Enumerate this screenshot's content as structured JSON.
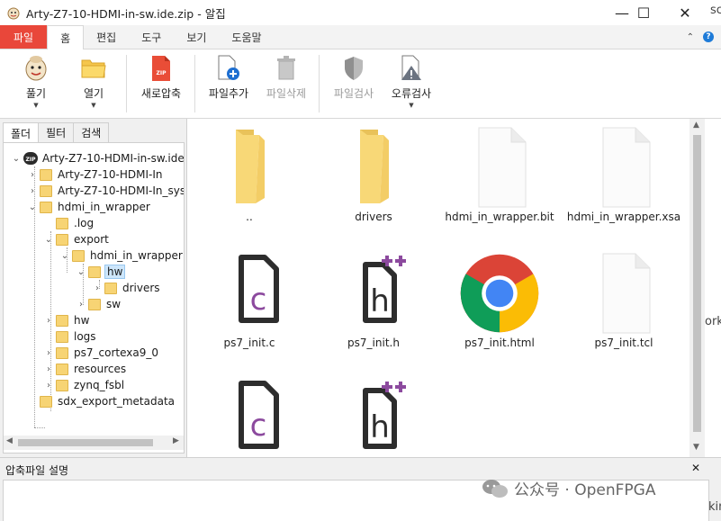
{
  "window": {
    "title": "Arty-Z7-10-HDMI-in-sw.ide.zip - 알집",
    "minimize": "—",
    "maximize": "☐",
    "close": "✕"
  },
  "ribbon_tabs": [
    "파일",
    "홈",
    "편집",
    "도구",
    "보기",
    "도움말"
  ],
  "ribbon": {
    "unzip": "풀기",
    "open": "열기",
    "new_zip": "새로압축",
    "add_file": "파일추가",
    "delete_file": "파일삭제",
    "check_file": "파일검사",
    "error_check": "오류검사"
  },
  "left_tabs": [
    "폴더",
    "필터",
    "검색"
  ],
  "tree": [
    {
      "label": "Arty-Z7-10-HDMI-in-sw.ide."
    },
    {
      "label": "Arty-Z7-10-HDMI-In"
    },
    {
      "label": "Arty-Z7-10-HDMI-In_sys"
    },
    {
      "label": "hdmi_in_wrapper"
    },
    {
      "label": ".log"
    },
    {
      "label": "export"
    },
    {
      "label": "hdmi_in_wrapper"
    },
    {
      "label": "hw"
    },
    {
      "label": "drivers"
    },
    {
      "label": "sw"
    },
    {
      "label": "hw"
    },
    {
      "label": "logs"
    },
    {
      "label": "ps7_cortexa9_0"
    },
    {
      "label": "resources"
    },
    {
      "label": "zynq_fsbl"
    },
    {
      "label": "sdx_export_metadata"
    }
  ],
  "files": [
    {
      "name": "..",
      "icon": "folder-icon"
    },
    {
      "name": "drivers",
      "icon": "folder-icon"
    },
    {
      "name": "hdmi_in_wrapper.bit",
      "icon": "blank-file-icon"
    },
    {
      "name": "hdmi_in_wrapper.xsa",
      "icon": "blank-file-icon"
    },
    {
      "name": "ps7_init.c",
      "icon": "c-source-icon"
    },
    {
      "name": "ps7_init.h",
      "icon": "h-header-icon"
    },
    {
      "name": "ps7_init.html",
      "icon": "chrome-icon"
    },
    {
      "name": "ps7_init.tcl",
      "icon": "blank-file-icon"
    },
    {
      "name": "",
      "icon": "c-source-icon"
    },
    {
      "name": "",
      "icon": "h-header-icon"
    }
  ],
  "bottom": {
    "title": "압축파일 설명",
    "close": "✕"
  },
  "watermark": "公众号 · OpenFPGA",
  "background_fragments": [
    "sc",
    "ork",
    "kin"
  ],
  "colors": {
    "file_tab": "#e9473a",
    "folder": "#f7d474",
    "c_purple": "#8c4a9e",
    "selection": "#cde6fb"
  }
}
